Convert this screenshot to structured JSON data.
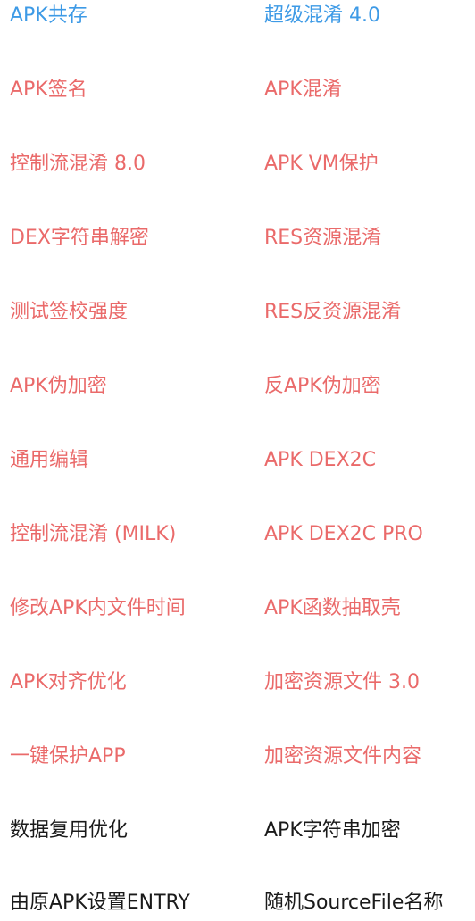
{
  "colors": {
    "blue": "#3d9ae6",
    "red": "#ea6a6a",
    "black": "#1a1a1a"
  },
  "rows": [
    {
      "left": {
        "label": "APK共存",
        "color": "blue"
      },
      "right": {
        "label": "超级混淆 4.0",
        "color": "blue"
      }
    },
    {
      "left": {
        "label": "APK签名",
        "color": "red"
      },
      "right": {
        "label": "APK混淆",
        "color": "red"
      }
    },
    {
      "left": {
        "label": "控制流混淆 8.0",
        "color": "red"
      },
      "right": {
        "label": "APK VM保护",
        "color": "red"
      }
    },
    {
      "left": {
        "label": "DEX字符串解密",
        "color": "red"
      },
      "right": {
        "label": "RES资源混淆",
        "color": "red"
      }
    },
    {
      "left": {
        "label": "测试签校强度",
        "color": "red"
      },
      "right": {
        "label": "RES反资源混淆",
        "color": "red"
      }
    },
    {
      "left": {
        "label": "APK伪加密",
        "color": "red"
      },
      "right": {
        "label": "反APK伪加密",
        "color": "red"
      }
    },
    {
      "left": {
        "label": "通用编辑",
        "color": "red"
      },
      "right": {
        "label": "APK DEX2C",
        "color": "red"
      }
    },
    {
      "left": {
        "label": "控制流混淆 (MILK)",
        "color": "red"
      },
      "right": {
        "label": "APK DEX2C PRO",
        "color": "red"
      }
    },
    {
      "left": {
        "label": "修改APK内文件时间",
        "color": "red"
      },
      "right": {
        "label": "APK函数抽取壳",
        "color": "red"
      }
    },
    {
      "left": {
        "label": "APK对齐优化",
        "color": "red"
      },
      "right": {
        "label": "加密资源文件 3.0",
        "color": "red"
      }
    },
    {
      "left": {
        "label": "一键保护APP",
        "color": "red"
      },
      "right": {
        "label": "加密资源文件内容",
        "color": "red"
      }
    },
    {
      "left": {
        "label": "数据复用优化",
        "color": "black"
      },
      "right": {
        "label": "APK字符串加密",
        "color": "black"
      }
    },
    {
      "left": {
        "label": "由原APK设置ENTRY",
        "color": "black"
      },
      "right": {
        "label": "随机SourceFile名称",
        "color": "black"
      }
    }
  ]
}
